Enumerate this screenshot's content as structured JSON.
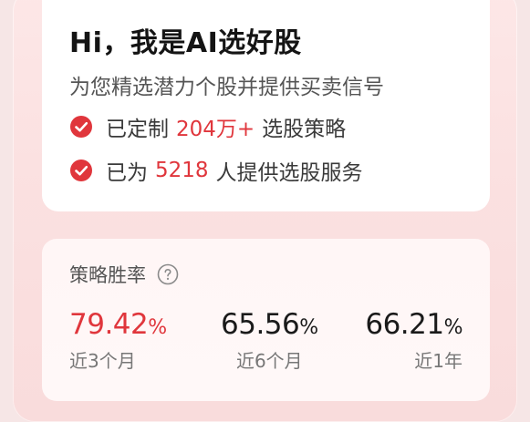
{
  "intro": {
    "title": "Hi，我是AI选好股",
    "subtitle": "为您精选潜力个股并提供买卖信号"
  },
  "features": [
    {
      "prefix": "已定制",
      "highlight": "204万+",
      "suffix": "选股策略",
      "icon": "check-circle-icon"
    },
    {
      "prefix": "已为",
      "highlight": "5218",
      "suffix": "人提供选股服务",
      "icon": "check-circle-icon"
    }
  ],
  "win_rate": {
    "title": "策略胜率",
    "help_icon": "question-circle-icon",
    "stats": [
      {
        "value": "79.42",
        "unit": "%",
        "label": "近3个月"
      },
      {
        "value": "65.56",
        "unit": "%",
        "label": "近6个月"
      },
      {
        "value": "66.21",
        "unit": "%",
        "label": "近1年"
      }
    ]
  },
  "colors": {
    "accent": "#e0363c",
    "panel_background": "#fbe1e1",
    "card_background": "#ffffff"
  }
}
